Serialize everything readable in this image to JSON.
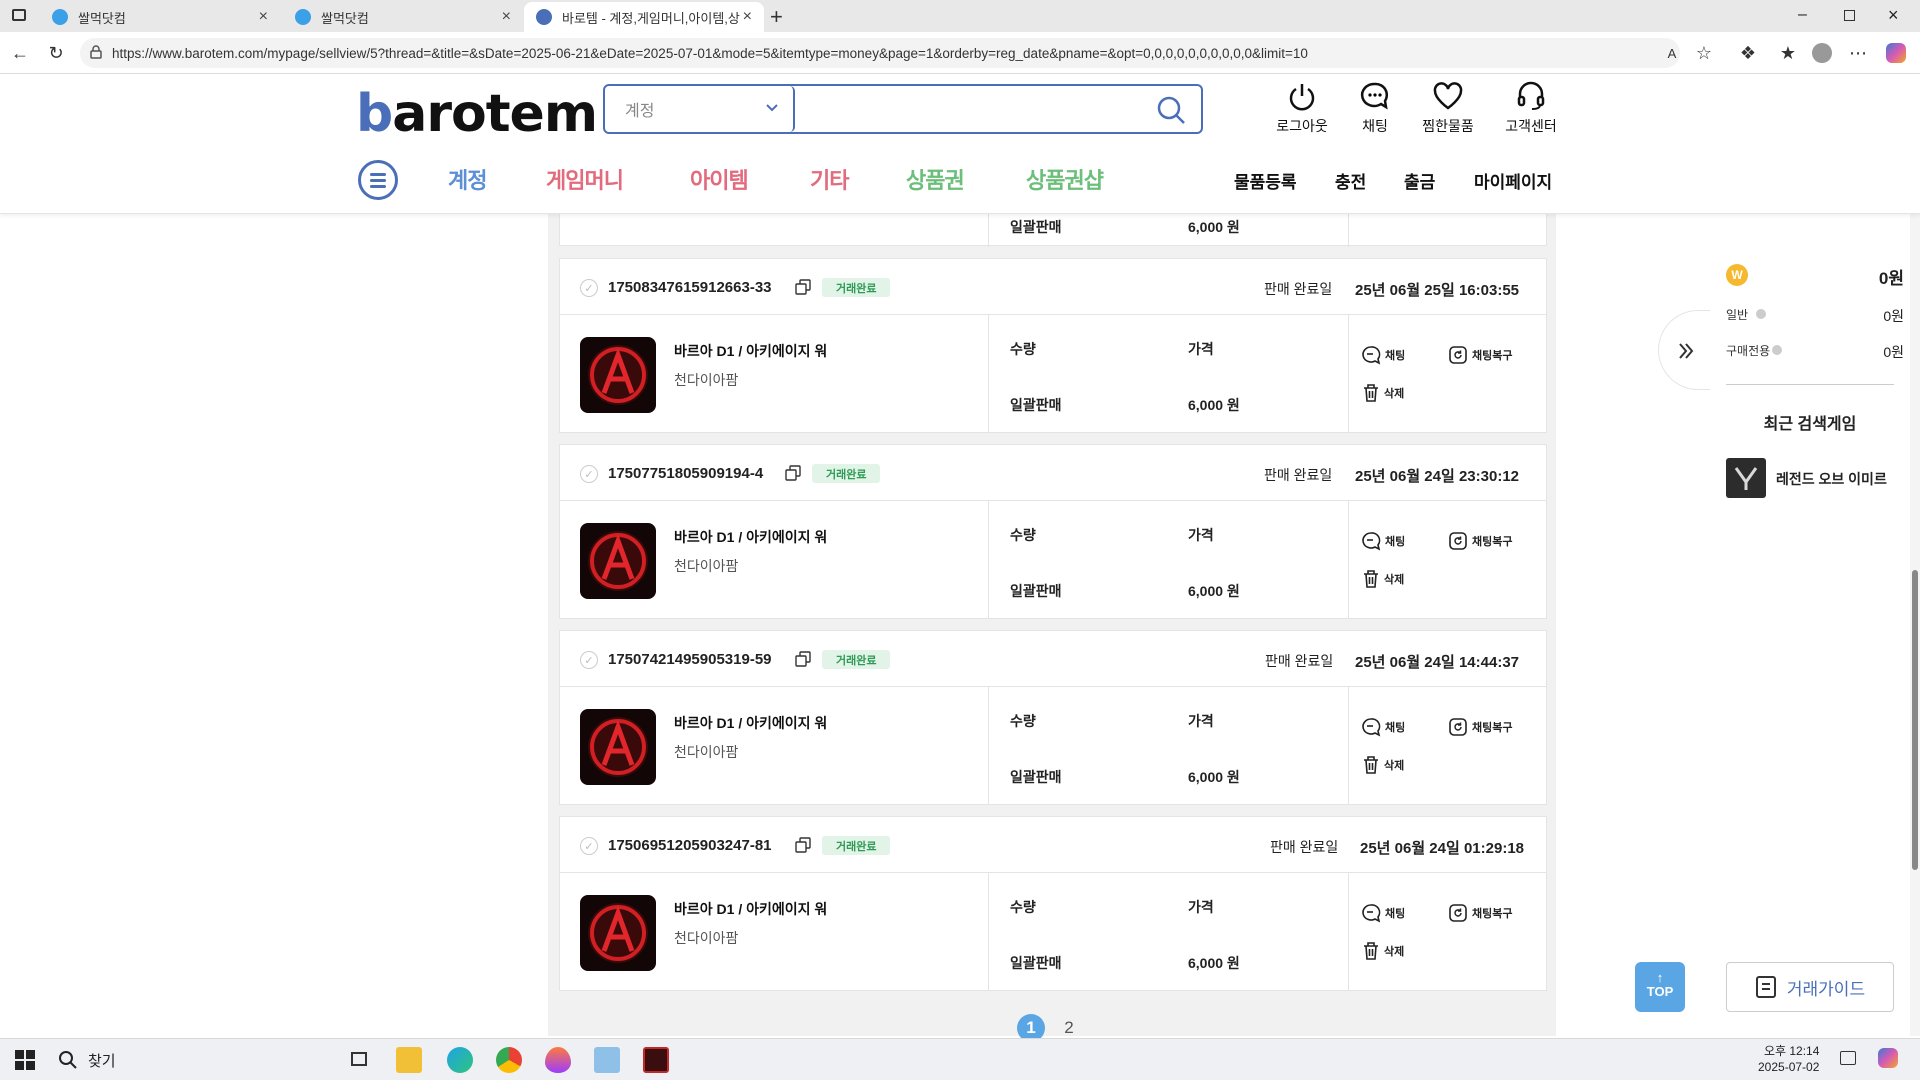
{
  "browser": {
    "tabs": [
      {
        "title": "쌀먹닷컴",
        "active": false
      },
      {
        "title": "쌀먹닷컴",
        "active": false
      },
      {
        "title": "바로템 - 계정,게임머니,아이템,상",
        "active": true
      }
    ],
    "url": "https://www.barotem.com/mypage/sellview/5?thread=&title=&sDate=2025-06-21&eDate=2025-07-01&mode=5&itemtype=money&page=1&orderby=reg_date&pname=&opt=0,0,0,0,0,0,0,0,0,0&limit=10"
  },
  "header": {
    "logo_b": "b",
    "logo_rest": "arotem",
    "search_category": "계정",
    "search_placeholder": "",
    "icons": {
      "logout": "로그아웃",
      "chat": "채팅",
      "wishlist": "찜한물품",
      "support": "고객센터"
    },
    "categories": [
      {
        "label": "계정",
        "color": "#5b8fd6"
      },
      {
        "label": "게임머니",
        "color": "#e26b7e"
      },
      {
        "label": "아이템",
        "color": "#e26b7e"
      },
      {
        "label": "기타",
        "color": "#e26b7e"
      },
      {
        "label": "상품권",
        "color": "#6bbf7a"
      },
      {
        "label": "상품권샵",
        "color": "#6bbf7a"
      }
    ],
    "sub_nav": {
      "register": "물품등록",
      "charge": "충전",
      "withdraw": "출금",
      "mypage": "마이페이지"
    }
  },
  "partial_card": {
    "label": "일괄판매",
    "price": "6,000 원"
  },
  "orders": [
    {
      "id": "17508347615912663-33",
      "status": "거래완료",
      "done_label": "판매 완료일",
      "done_time": "25년 06월 25일 16:03:55",
      "game": "바르아 D1 / 아키에이지 워",
      "server": "천다이아팜",
      "qty_label": "수량",
      "price_label": "가격",
      "type": "일괄판매",
      "price": "6,000 원",
      "chat": "채팅",
      "chat_restore": "채팅복구",
      "delete": "삭제"
    },
    {
      "id": "17507751805909194-4",
      "status": "거래완료",
      "done_label": "판매 완료일",
      "done_time": "25년 06월 24일 23:30:12",
      "game": "바르아 D1 / 아키에이지 워",
      "server": "천다이아팜",
      "qty_label": "수량",
      "price_label": "가격",
      "type": "일괄판매",
      "price": "6,000 원",
      "chat": "채팅",
      "chat_restore": "채팅복구",
      "delete": "삭제"
    },
    {
      "id": "17507421495905319-59",
      "status": "거래완료",
      "done_label": "판매 완료일",
      "done_time": "25년 06월 24일 14:44:37",
      "game": "바르아 D1 / 아키에이지 워",
      "server": "천다이아팜",
      "qty_label": "수량",
      "price_label": "가격",
      "type": "일괄판매",
      "price": "6,000 원",
      "chat": "채팅",
      "chat_restore": "채팅복구",
      "delete": "삭제"
    },
    {
      "id": "17506951205903247-81",
      "status": "거래완료",
      "done_label": "판매 완료일",
      "done_time": "25년 06월 24일 01:29:18",
      "game": "바르아 D1 / 아키에이지 워",
      "server": "천다이아팜",
      "qty_label": "수량",
      "price_label": "가격",
      "type": "일괄판매",
      "price": "6,000 원",
      "chat": "채팅",
      "chat_restore": "채팅복구",
      "delete": "삭제"
    }
  ],
  "pagination": {
    "pages": [
      "1",
      "2"
    ],
    "current": "1"
  },
  "sidebar": {
    "coin_symbol": "W",
    "balance": "0원",
    "general_label": "일반",
    "general_value": "0원",
    "purchase_label": "구매전용",
    "purchase_value": "0원",
    "recent_title": "최근 검색게임",
    "recent_game": "레전드 오브 이미르"
  },
  "top_button": "TOP",
  "guide_button": "거래가이드",
  "taskbar": {
    "search": "찾기",
    "ampm_time": "오후 12:14",
    "date": "2025-07-02"
  }
}
